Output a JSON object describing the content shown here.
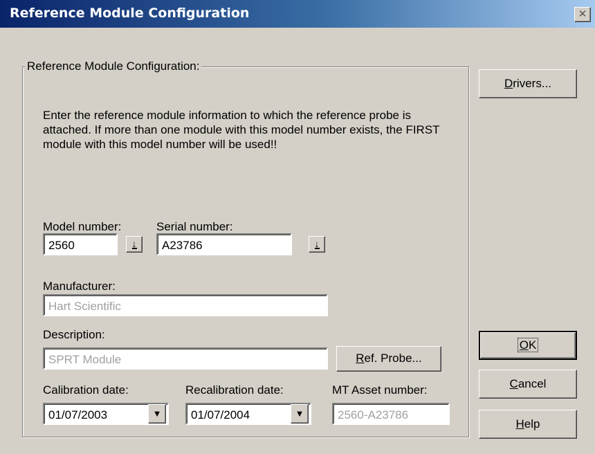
{
  "window": {
    "title": "Reference Module Configuration",
    "close_glyph": "✕"
  },
  "group": {
    "legend": "Reference Module Configuration:",
    "description": "Enter the reference module information to which the reference probe is attached. If more than one module with this model number exists, the FIRST module with this model number will be used!!"
  },
  "model": {
    "label": "Model number:",
    "value": "2560"
  },
  "serial": {
    "label": "Serial number:",
    "value": "A23786"
  },
  "manufacturer": {
    "label": "Manufacturer:",
    "value": "Hart Scientific"
  },
  "description_field": {
    "label": "Description:",
    "value": "SPRT Module"
  },
  "calibration": {
    "label": "Calibration date:",
    "value": "01/07/2003"
  },
  "recalibration": {
    "label": "Recalibration date:",
    "value": "01/07/2004"
  },
  "asset": {
    "label": "MT Asset number:",
    "value": "2560-A23786"
  },
  "buttons": {
    "drivers": {
      "mnemonic": "D",
      "rest": "rivers..."
    },
    "ref_probe": {
      "mnemonic": "R",
      "rest": "ef. Probe..."
    },
    "ok": {
      "mnemonic": "O",
      "rest": "K"
    },
    "cancel": {
      "mnemonic": "C",
      "rest": "ancel"
    },
    "help": {
      "mnemonic": "H",
      "rest": "elp"
    }
  },
  "icons": {
    "pick": "↓",
    "dropdown": "▼"
  },
  "colors": {
    "titlebar_start": "#0a246a",
    "titlebar_end": "#a6caf0",
    "dialog_bg": "#d4d0c8",
    "disabled_text": "#a0a0a0"
  }
}
